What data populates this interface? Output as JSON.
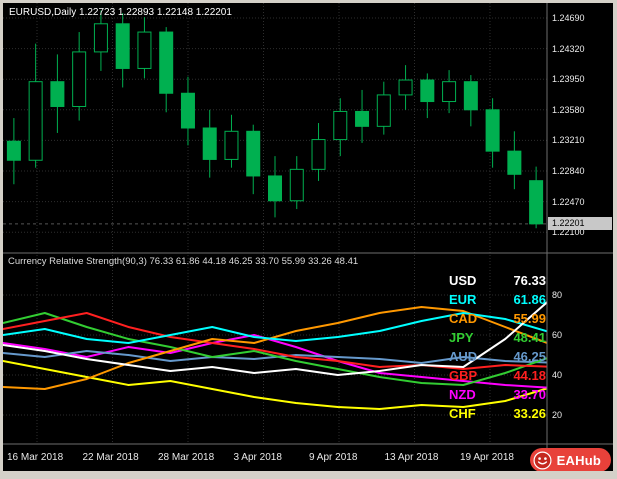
{
  "window": {
    "background": "#000000",
    "frame_color": "#d4d0c8"
  },
  "chart_header": {
    "title": "EURUSD,Daily 1.22723 1.22893 1.22148 1.22201"
  },
  "price_axis": {
    "ticks": [
      "1.24690",
      "1.24320",
      "1.23950",
      "1.23580",
      "1.23210",
      "1.22840",
      "1.22470",
      "1.22100"
    ],
    "current": "1.22201"
  },
  "time_axis": {
    "labels": [
      "16 Mar 2018",
      "22 Mar 2018",
      "28 Mar 2018",
      "3 Apr 2018",
      "9 Apr 2018",
      "13 Apr 2018",
      "19 Apr 2018"
    ]
  },
  "indicator_header": {
    "text": "Currency Relative Strength(90,3) 76.33 61.86 44.18 46.25 33.70 55.99 33.26 48.41"
  },
  "legend": [
    {
      "code": "USD",
      "value": "76.33",
      "color": "#FFFFFF"
    },
    {
      "code": "EUR",
      "value": "61.86",
      "color": "#00FFFF"
    },
    {
      "code": "CAD",
      "value": "55.99",
      "color": "#FF9800"
    },
    {
      "code": "JPY",
      "value": "48.41",
      "color": "#32CD32"
    },
    {
      "code": "AUD",
      "value": "46.25",
      "color": "#6699CC"
    },
    {
      "code": "GBP",
      "value": "44.18",
      "color": "#FF2020"
    },
    {
      "code": "NZD",
      "value": "33.70",
      "color": "#FF00FF"
    },
    {
      "code": "CHF",
      "value": "33.26",
      "color": "#FFFF00"
    }
  ],
  "branding": {
    "label": "EAHub",
    "badge_color": "#e8413a"
  },
  "chart_data": {
    "type": "candlestick+line",
    "symbol": "EURUSD",
    "timeframe": "Daily",
    "ohlc_display": {
      "open": "1.22723",
      "high": "1.22893",
      "low": "1.22148",
      "close": "1.22201"
    },
    "price_ticks": [
      1.2469,
      1.2432,
      1.2395,
      1.2358,
      1.2321,
      1.2284,
      1.2247,
      1.221
    ],
    "current_price": 1.22201,
    "candle_colors": {
      "up_fill": "#000000",
      "down_fill": "#00B050",
      "outline": "#00B050",
      "wick": "#00B050"
    },
    "candles": [
      [
        1.232,
        1.2348,
        1.2268,
        1.2297
      ],
      [
        1.2297,
        1.2438,
        1.2288,
        1.2392
      ],
      [
        1.2392,
        1.2425,
        1.233,
        1.2362
      ],
      [
        1.2362,
        1.2452,
        1.2345,
        1.2428
      ],
      [
        1.2428,
        1.2478,
        1.2405,
        1.2462
      ],
      [
        1.2462,
        1.2475,
        1.2385,
        1.2408
      ],
      [
        1.2408,
        1.247,
        1.2396,
        1.2452
      ],
      [
        1.2452,
        1.2458,
        1.2355,
        1.2378
      ],
      [
        1.2378,
        1.2398,
        1.2315,
        1.2336
      ],
      [
        1.2336,
        1.2358,
        1.2276,
        1.2298
      ],
      [
        1.2298,
        1.2352,
        1.2288,
        1.2332
      ],
      [
        1.2332,
        1.234,
        1.2256,
        1.2278
      ],
      [
        1.2278,
        1.2302,
        1.2228,
        1.2248
      ],
      [
        1.2248,
        1.2302,
        1.2238,
        1.2286
      ],
      [
        1.2286,
        1.2342,
        1.2272,
        1.2322
      ],
      [
        1.2322,
        1.2372,
        1.2302,
        1.2356
      ],
      [
        1.2356,
        1.2382,
        1.2318,
        1.2338
      ],
      [
        1.2338,
        1.2392,
        1.2328,
        1.2376
      ],
      [
        1.2376,
        1.2412,
        1.2358,
        1.2394
      ],
      [
        1.2394,
        1.2402,
        1.2348,
        1.2368
      ],
      [
        1.2368,
        1.2406,
        1.2354,
        1.2392
      ],
      [
        1.2392,
        1.24,
        1.2338,
        1.2358
      ],
      [
        1.2358,
        1.2372,
        1.2288,
        1.2308
      ],
      [
        1.2308,
        1.2332,
        1.2262,
        1.228
      ],
      [
        1.22723,
        1.22893,
        1.22148,
        1.22201
      ]
    ],
    "indicator": {
      "name": "Currency Relative Strength",
      "params": "(90,3)",
      "y_ticks": [
        80,
        60,
        40,
        20
      ],
      "series": [
        {
          "name": "CHF",
          "color": "#FFFF00",
          "last": 33.26,
          "values": [
            47,
            43,
            39,
            35,
            37,
            33,
            29,
            26,
            24,
            23,
            25,
            24,
            27,
            33.26
          ]
        },
        {
          "name": "NZD",
          "color": "#FF00FF",
          "last": 33.7,
          "values": [
            56,
            53,
            49,
            54,
            51,
            56,
            60,
            54,
            47,
            41,
            39,
            37,
            35,
            33.7
          ]
        },
        {
          "name": "AUD",
          "color": "#6699CC",
          "last": 46.25,
          "values": [
            51,
            49,
            52,
            50,
            47,
            49,
            48,
            50,
            49,
            48,
            46,
            49,
            47,
            46.25
          ]
        },
        {
          "name": "JPY",
          "color": "#32CD32",
          "last": 48.41,
          "values": [
            66,
            71,
            64,
            58,
            54,
            49,
            52,
            47,
            43,
            39,
            36,
            35,
            41,
            48.41
          ]
        },
        {
          "name": "GBP",
          "color": "#FF2020",
          "last": 44.18,
          "values": [
            63,
            67,
            71,
            64,
            59,
            56,
            53,
            49,
            47,
            44,
            45,
            43,
            45,
            44.18
          ]
        },
        {
          "name": "CAD",
          "color": "#FF9800",
          "last": 55.99,
          "values": [
            34,
            33,
            38,
            46,
            52,
            58,
            56,
            62,
            66,
            71,
            74,
            72,
            64,
            55.99
          ]
        },
        {
          "name": "EUR",
          "color": "#00FFFF",
          "last": 61.86,
          "values": [
            60,
            63,
            58,
            56,
            60,
            64,
            59,
            57,
            59,
            62,
            67,
            71,
            68,
            61.86
          ]
        },
        {
          "name": "USD",
          "color": "#FFFFFF",
          "last": 76.33,
          "values": [
            55,
            52,
            48,
            45,
            42,
            44,
            41,
            43,
            40,
            42,
            45,
            44,
            58,
            76.33
          ]
        }
      ]
    }
  }
}
